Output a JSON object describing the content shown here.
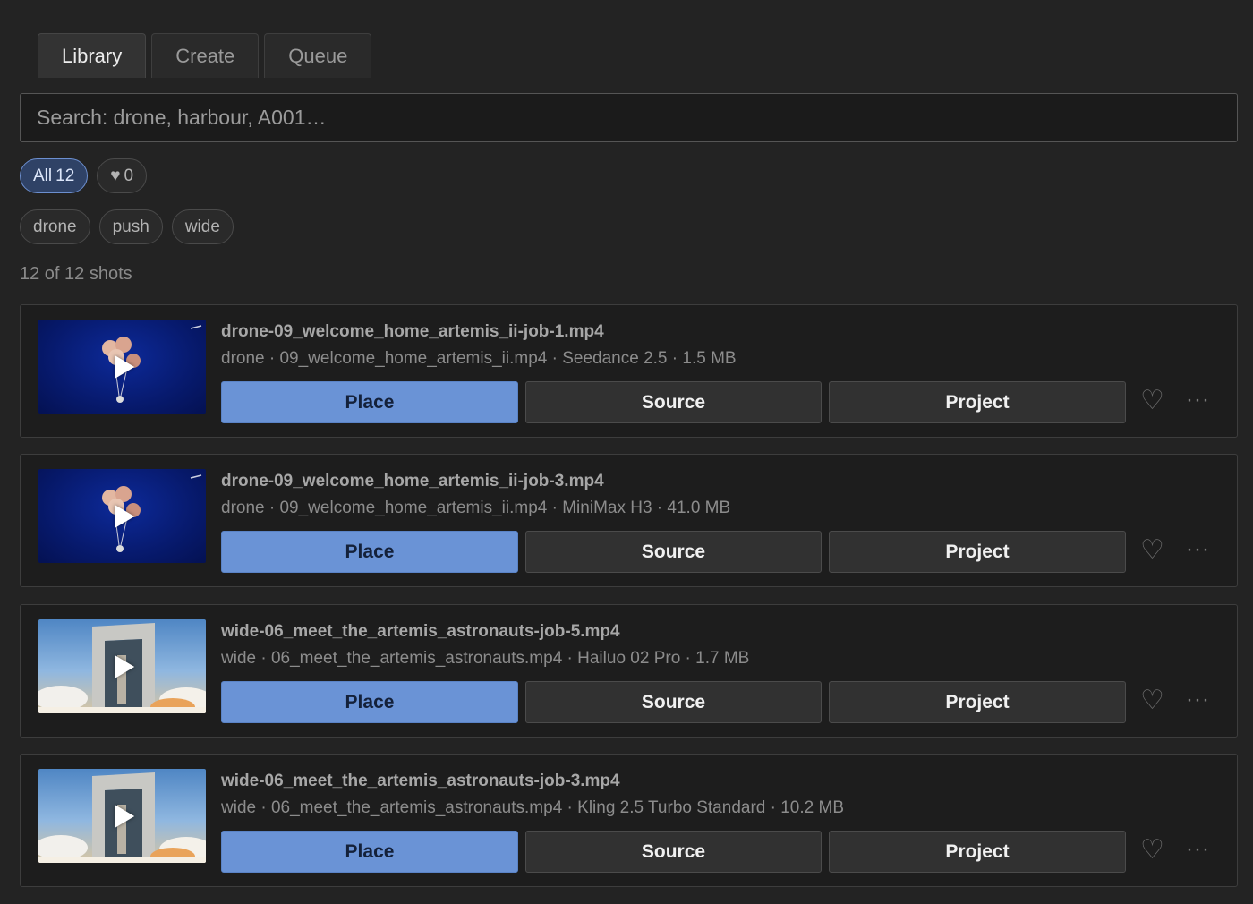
{
  "tabs": [
    {
      "label": "Library",
      "active": true
    },
    {
      "label": "Create",
      "active": false
    },
    {
      "label": "Queue",
      "active": false
    }
  ],
  "search": {
    "placeholder": "Search: drone, harbour, A001…",
    "value": ""
  },
  "filters": {
    "all": {
      "label": "All",
      "count": "12"
    },
    "favorites": {
      "icon": "♥",
      "count": "0"
    }
  },
  "tags": [
    "drone",
    "push",
    "wide"
  ],
  "result_count": "12 of 12 shots",
  "colors": {
    "accent": "#6a93d6",
    "background": "#232323",
    "card": "#1d1d1d"
  },
  "actions": {
    "place": "Place",
    "source": "Source",
    "project": "Project",
    "favorite_icon": "♡",
    "more_icon": "···"
  },
  "shots": [
    {
      "title": "drone-09_welcome_home_artemis_ii-job-1.mp4",
      "meta": "drone · 09_welcome_home_artemis_ii.mp4 · Seedance 2.5 · 1.5 MB",
      "thumb": "parachute-capsule-space"
    },
    {
      "title": "drone-09_welcome_home_artemis_ii-job-3.mp4",
      "meta": "drone · 09_welcome_home_artemis_ii.mp4 · MiniMax H3 · 41.0 MB",
      "thumb": "parachute-capsule-space"
    },
    {
      "title": "wide-06_meet_the_artemis_astronauts-job-5.mp4",
      "meta": "wide · 06_meet_the_artemis_astronauts.mp4 · Hailuo 02 Pro · 1.7 MB",
      "thumb": "rocket-launch-gantry"
    },
    {
      "title": "wide-06_meet_the_artemis_astronauts-job-3.mp4",
      "meta": "wide · 06_meet_the_artemis_astronauts.mp4 · Kling 2.5 Turbo Standard · 10.2 MB",
      "thumb": "rocket-launch-gantry"
    }
  ]
}
